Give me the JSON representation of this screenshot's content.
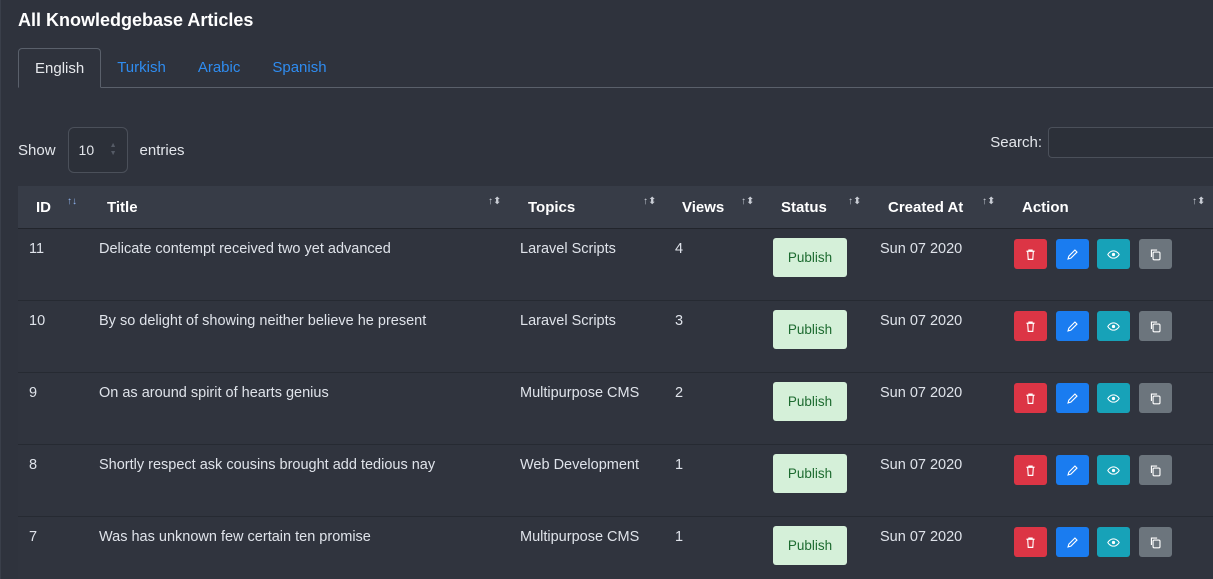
{
  "page_title": "All Knowledgebase Articles",
  "tabs": [
    {
      "label": "English",
      "active": true
    },
    {
      "label": "Turkish",
      "active": false
    },
    {
      "label": "Arabic",
      "active": false
    },
    {
      "label": "Spanish",
      "active": false
    }
  ],
  "length_control": {
    "show_label": "Show",
    "value": "10",
    "entries_label": "entries"
  },
  "search": {
    "label": "Search:",
    "value": ""
  },
  "columns": [
    "ID",
    "Title",
    "Topics",
    "Views",
    "Status",
    "Created At",
    "Action"
  ],
  "sort_icons": {
    "id": "sort-desc-icon",
    "others": "sort-both-icon"
  },
  "rows": [
    {
      "id": "11",
      "title": "Delicate contempt received two yet advanced",
      "topic": "Laravel Scripts",
      "views": "4",
      "status": "Publish",
      "created": "Sun 07 2020"
    },
    {
      "id": "10",
      "title": "By so delight of showing neither believe he present",
      "topic": "Laravel Scripts",
      "views": "3",
      "status": "Publish",
      "created": "Sun 07 2020"
    },
    {
      "id": "9",
      "title": "On as around spirit of hearts genius",
      "topic": "Multipurpose CMS",
      "views": "2",
      "status": "Publish",
      "created": "Sun 07 2020"
    },
    {
      "id": "8",
      "title": "Shortly respect ask cousins brought add tedious nay",
      "topic": "Web Development",
      "views": "1",
      "status": "Publish",
      "created": "Sun 07 2020"
    },
    {
      "id": "7",
      "title": "Was has unknown few certain ten promise",
      "topic": "Multipurpose CMS",
      "views": "1",
      "status": "Publish",
      "created": "Sun 07 2020"
    }
  ],
  "action_icons": [
    "trash-icon",
    "pencil-icon",
    "eye-icon",
    "copy-icon"
  ],
  "colors": {
    "delete": "#dc3545",
    "edit": "#1a7cf0",
    "view": "#17a2b8",
    "copy": "#6c757d",
    "publish_bg": "#d5f0d9",
    "tab_link": "#2f8cf0"
  }
}
